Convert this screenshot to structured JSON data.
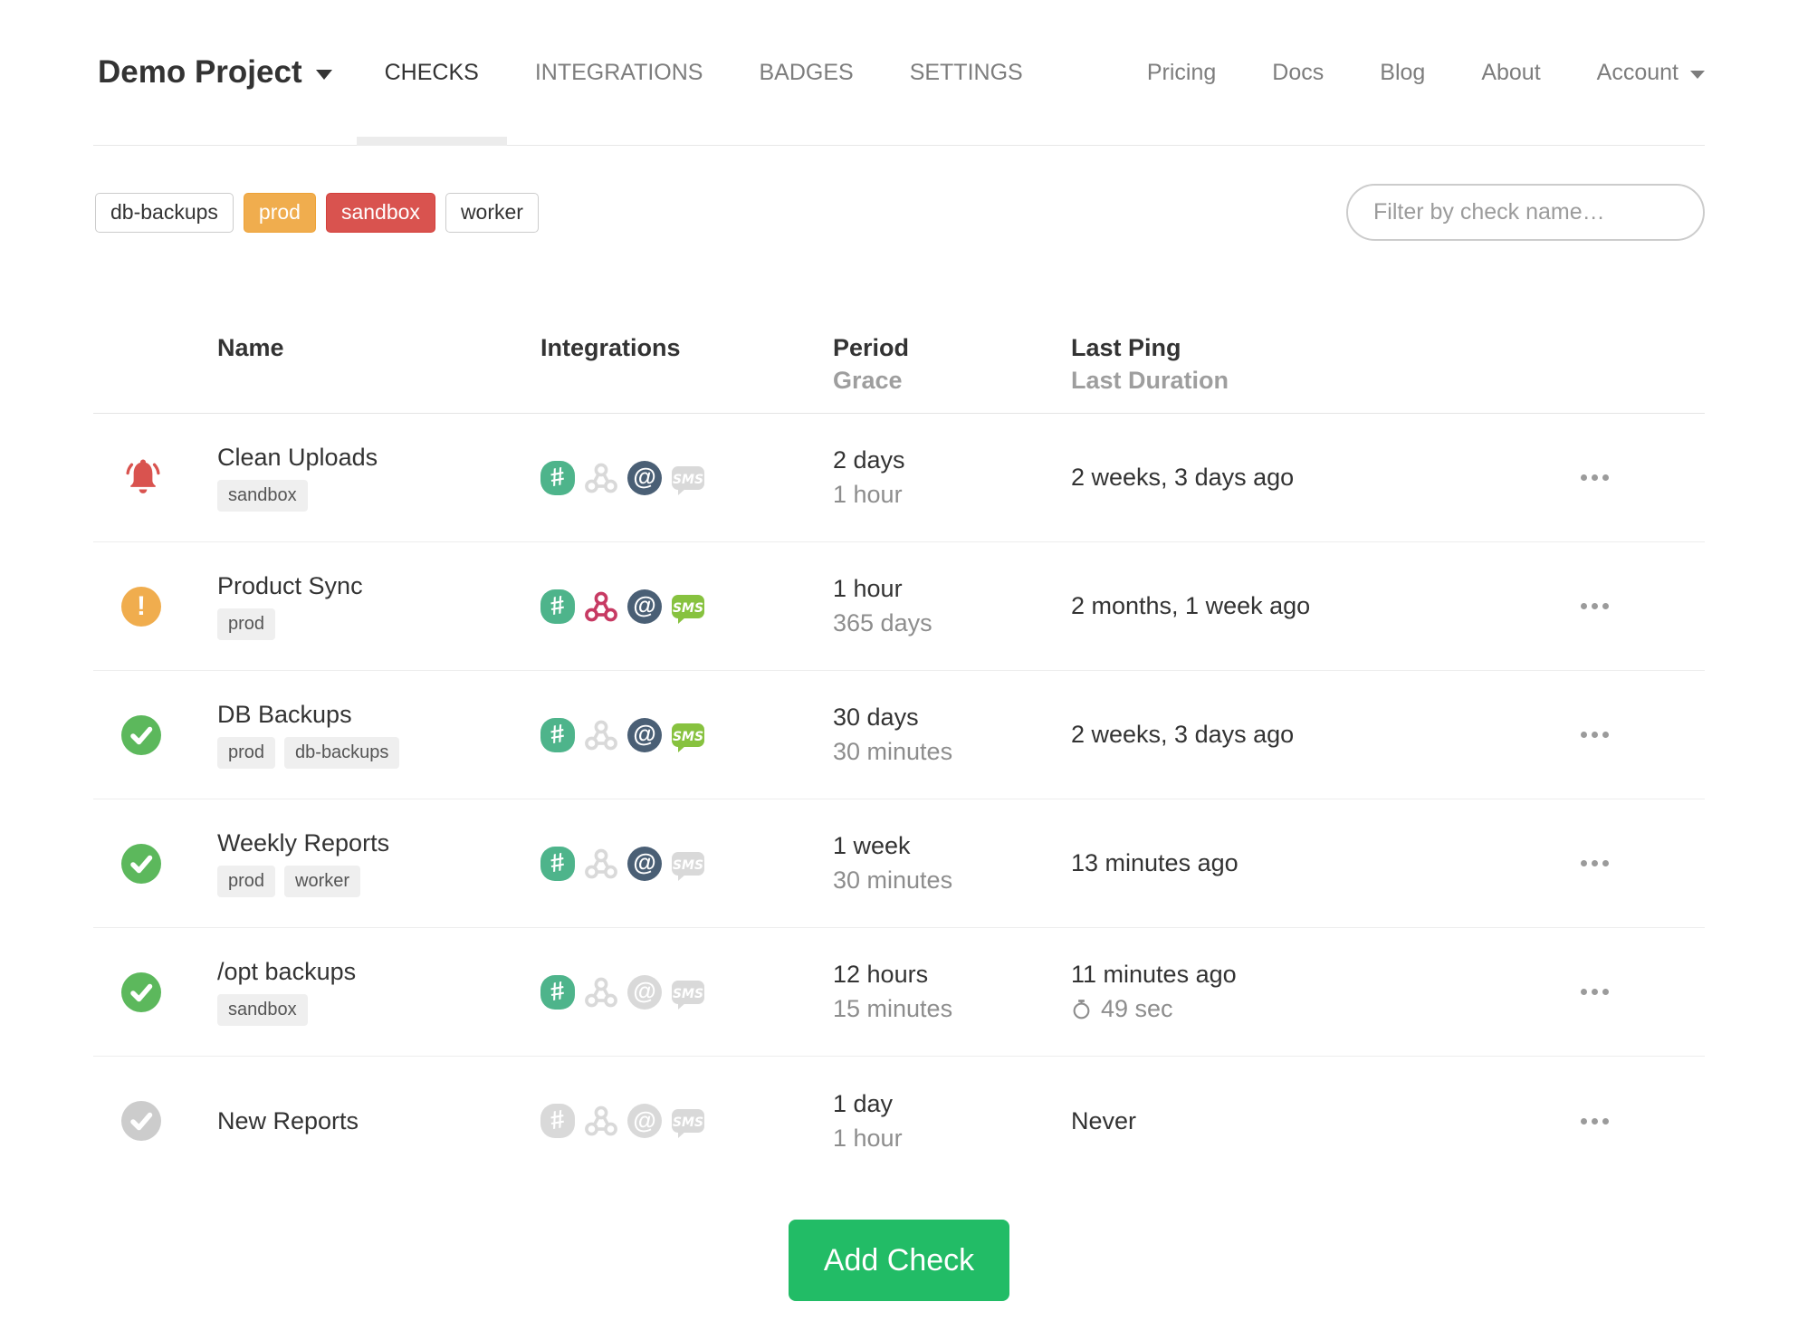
{
  "nav": {
    "project_name": "Demo Project",
    "tabs": [
      {
        "label": "CHECKS",
        "active": true
      },
      {
        "label": "INTEGRATIONS",
        "active": false
      },
      {
        "label": "BADGES",
        "active": false
      },
      {
        "label": "SETTINGS",
        "active": false
      }
    ],
    "links": [
      "Pricing",
      "Docs",
      "Blog",
      "About"
    ],
    "account_label": "Account"
  },
  "filter_bar": {
    "tag_buttons": [
      {
        "label": "db-backups",
        "variant": "outline"
      },
      {
        "label": "prod",
        "variant": "orange"
      },
      {
        "label": "sandbox",
        "variant": "red"
      },
      {
        "label": "worker",
        "variant": "outline"
      }
    ],
    "search_placeholder": "Filter by check name…"
  },
  "table": {
    "headers": {
      "name": "Name",
      "integrations": "Integrations",
      "period": "Period",
      "grace": "Grace",
      "last_ping": "Last Ping",
      "last_duration": "Last Duration"
    },
    "rows": [
      {
        "status": "alert",
        "name": "Clean Uploads",
        "tags": [
          "sandbox"
        ],
        "integrations": {
          "slack": true,
          "webhook": false,
          "email": true,
          "sms": false
        },
        "period": "2 days",
        "grace": "1 hour",
        "last_ping": "2 weeks, 3 days ago",
        "last_duration": ""
      },
      {
        "status": "late",
        "name": "Product Sync",
        "tags": [
          "prod"
        ],
        "integrations": {
          "slack": true,
          "webhook": true,
          "email": true,
          "sms": true
        },
        "period": "1 hour",
        "grace": "365 days",
        "last_ping": "2 months, 1 week ago",
        "last_duration": ""
      },
      {
        "status": "up",
        "name": "DB Backups",
        "tags": [
          "prod",
          "db-backups"
        ],
        "integrations": {
          "slack": true,
          "webhook": false,
          "email": true,
          "sms": true
        },
        "period": "30 days",
        "grace": "30 minutes",
        "last_ping": "2 weeks, 3 days ago",
        "last_duration": ""
      },
      {
        "status": "up",
        "name": "Weekly Reports",
        "tags": [
          "prod",
          "worker"
        ],
        "integrations": {
          "slack": true,
          "webhook": false,
          "email": true,
          "sms": false
        },
        "period": "1 week",
        "grace": "30 minutes",
        "last_ping": "13 minutes ago",
        "last_duration": ""
      },
      {
        "status": "up",
        "name": "/opt backups",
        "tags": [
          "sandbox"
        ],
        "integrations": {
          "slack": true,
          "webhook": false,
          "email": false,
          "sms": false
        },
        "period": "12 hours",
        "grace": "15 minutes",
        "last_ping": "11 minutes ago",
        "last_duration": "49 sec"
      },
      {
        "status": "new",
        "name": "New Reports",
        "tags": [],
        "integrations": {
          "slack": false,
          "webhook": false,
          "email": false,
          "sms": false
        },
        "period": "1 day",
        "grace": "1 hour",
        "last_ping": "Never",
        "last_duration": ""
      }
    ]
  },
  "buttons": {
    "add_check": "Add Check"
  },
  "icons": {
    "project_caret": "chevron-down",
    "account_caret": "chevron-down",
    "status_alert": "bell",
    "status_late": "exclamation-circle",
    "status_up": "check-circle",
    "status_new": "check-circle",
    "integration_set": [
      "slack",
      "webhook",
      "email",
      "sms"
    ],
    "duration": "stopwatch",
    "row_menu": "ellipsis"
  },
  "colors": {
    "accent_green": "#22bc66",
    "status_alert": "#d9534f",
    "status_late": "#f0ad4e",
    "status_up": "#5cb85c",
    "status_new": "#cccccc",
    "tag_orange": "#f0ad4e",
    "tag_red": "#d9534f",
    "slack_green": "#4eb48b",
    "webhook_crimson": "#c73a63",
    "email_slate": "#4a5f75",
    "sms_green": "#87c23f",
    "integration_off": "#d9d9d9"
  }
}
